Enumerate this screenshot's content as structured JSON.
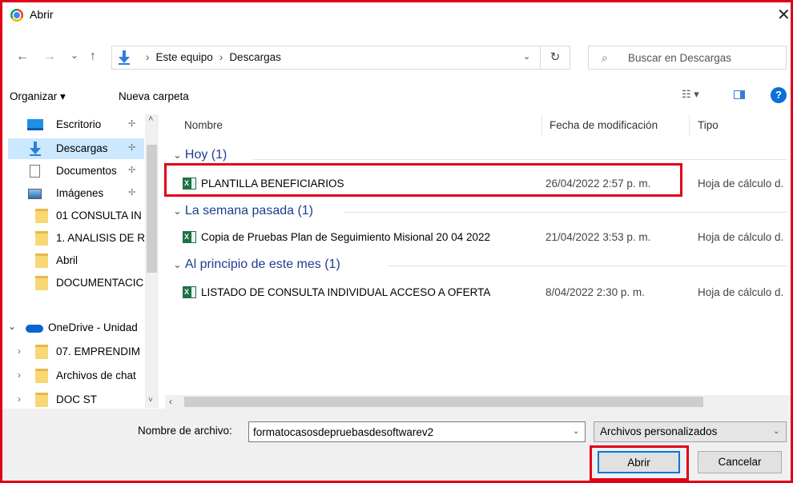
{
  "window": {
    "title": "Abrir",
    "close_glyph": "✕",
    "app_icon": "chrome-icon"
  },
  "nav": {
    "back": "←",
    "forward": "→",
    "recent": "⌄",
    "up": "↑"
  },
  "address": {
    "crumbs": [
      "Este equipo",
      "Descargas"
    ],
    "separator": "›",
    "dropdown": "⌄",
    "refresh": "↻"
  },
  "search": {
    "placeholder": "Buscar en Descargas",
    "icon": "⌕"
  },
  "toolbar": {
    "organize": "Organizar ▾",
    "new_folder": "Nueva carpeta",
    "view_glyph": "☷ ▾",
    "help": "?"
  },
  "sidebar": {
    "items": [
      {
        "label": "Escritorio",
        "pin": "📌",
        "icon": "desktop-icon"
      },
      {
        "label": "Descargas",
        "pin": "📌",
        "icon": "download-arrow-icon",
        "selected": true
      },
      {
        "label": "Documentos",
        "pin": "📌",
        "icon": "document-icon"
      },
      {
        "label": "Imágenes",
        "pin": "📌",
        "icon": "pictures-icon"
      },
      {
        "label": "01 CONSULTA IN",
        "icon": "folder-icon"
      },
      {
        "label": "1. ANALISIS DE R",
        "icon": "folder-icon"
      },
      {
        "label": "Abril",
        "icon": "folder-icon"
      },
      {
        "label": "DOCUMENTACIC",
        "icon": "folder-icon"
      },
      {
        "label": "OneDrive - Unidad",
        "icon": "onedrive-cloud-icon"
      },
      {
        "label": "07. EMPRENDIM",
        "icon": "shared-folder-icon"
      },
      {
        "label": "Archivos de chat",
        "icon": "folder-icon"
      },
      {
        "label": "DOC ST",
        "icon": "shared-folder-icon"
      }
    ]
  },
  "columns": {
    "name": "Nombre",
    "date": "Fecha de modificación",
    "type": "Tipo"
  },
  "groups": [
    {
      "title": "Hoy (1)",
      "files": [
        {
          "name": "PLANTILLA BENEFICIARIOS",
          "date": "26/04/2022 2:57 p. m.",
          "type": "Hoja de cálculo d."
        }
      ]
    },
    {
      "title": "La semana pasada (1)",
      "files": [
        {
          "name": "Copia de Pruebas Plan de Seguimiento Misional 20 04 2022",
          "date": "21/04/2022 3:53 p. m.",
          "type": "Hoja de cálculo d."
        }
      ]
    },
    {
      "title": "Al principio de este mes (1)",
      "files": [
        {
          "name": "LISTADO DE CONSULTA INDIVIDUAL ACCESO A OFERTA",
          "date": "8/04/2022 2:30 p. m.",
          "type": "Hoja de cálculo d."
        }
      ]
    }
  ],
  "footer": {
    "filename_label": "Nombre de archivo:",
    "filename_value": "formatocasosdepruebasdesoftwarev2",
    "filetype_value": "Archivos personalizados",
    "open_label": "Abrir",
    "cancel_label": "Cancelar"
  },
  "colors": {
    "highlight": "#e0001a",
    "selection": "#cce8ff",
    "accent": "#0078d7"
  }
}
